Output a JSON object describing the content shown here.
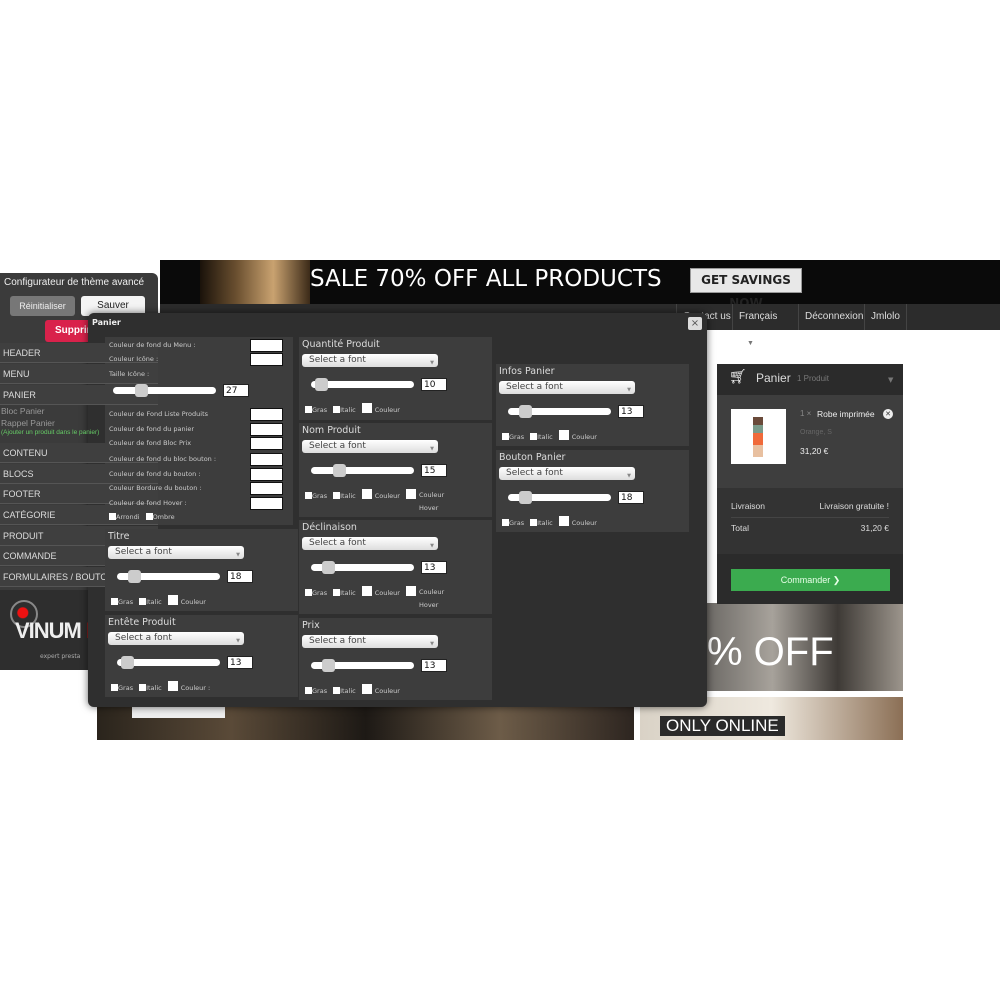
{
  "banner": {
    "sale_text": "SALE 70% OFF ALL PRODUCTS",
    "cta": "GET SAVINGS NOW"
  },
  "nav": {
    "items": [
      "Contact us",
      "Français",
      "Déconnexion",
      "Jmlolo"
    ]
  },
  "hero": {
    "off_text": "% OFF",
    "only_online": "ONLY ONLINE"
  },
  "configurator": {
    "title": "Configurateur de thème avancé",
    "reset": "Réinitialiser",
    "save": "Sauver",
    "delete": "Supprimer",
    "menu": [
      "HEADER",
      "MENU",
      "PANIER",
      "CONTENU",
      "BLOCS",
      "FOOTER",
      "CATÉGORIE",
      "PRODUIT",
      "COMMANDE",
      "FORMULAIRES / BOUTONS"
    ],
    "submenu": [
      "Bloc Panier",
      "Rappel Panier"
    ],
    "hint": "(Ajouter un produit dans le panier)",
    "logo_text": "VINUM MA",
    "logo_sub": "expert presta"
  },
  "modal": {
    "title": "Panier",
    "close": "×",
    "colors": {
      "labels": [
        "Couleur de fond du Menu :",
        "Couleur Icône :",
        "Couleur de Fond Liste Produits",
        "Couleur de fond du panier",
        "Couleur de fond Bloc Prix",
        "Couleur de fond du bloc bouton :",
        "Couleur de fond du bouton :",
        "Couleur Bordure du bouton :",
        "Couleur de fond Hover :"
      ],
      "icon_size_label": "Taille Icône :",
      "icon_size": 27,
      "rounded": "Arrondi",
      "shadow": "Ombre"
    },
    "font_placeholder": "Select a font",
    "checks": {
      "bold": "Gras",
      "italic": "Italic",
      "color": "Couleur",
      "color_suffix": "Couleur :",
      "hover": "Couleur Hover"
    },
    "sections": [
      {
        "title": "Titre",
        "size": 18
      },
      {
        "title": "Entête Produit",
        "size": 13
      },
      {
        "title": "Quantité Produit",
        "size": 10
      },
      {
        "title": "Nom Produit",
        "size": 15
      },
      {
        "title": "Déclinaison",
        "size": 13
      },
      {
        "title": "Prix",
        "size": 13
      },
      {
        "title": "Infos Panier",
        "size": 13
      },
      {
        "title": "Bouton Panier",
        "size": 18
      }
    ]
  },
  "cart": {
    "title": "Panier",
    "count": "1 Produit",
    "item": {
      "qty": "1 ×",
      "name": "Robe imprimée",
      "attributes": "Orange, S",
      "price": "31,20 €"
    },
    "shipping_label": "Livraison",
    "shipping_value": "Livraison gratuite !",
    "total_label": "Total",
    "total_value": "31,20 €",
    "order_button": "Commander ❯",
    "accent": "#3bab4f"
  }
}
